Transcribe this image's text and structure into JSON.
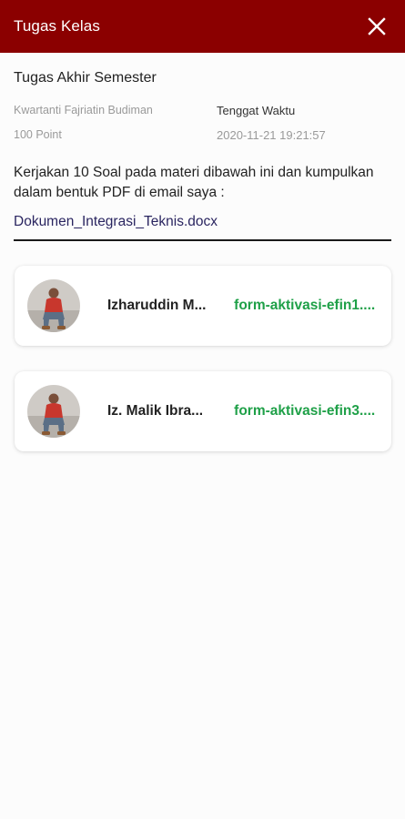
{
  "appbar": {
    "title": "Tugas Kelas",
    "close_icon": "close-icon",
    "background": "#8b0000"
  },
  "task": {
    "title": "Tugas Akhir Semester",
    "teacher": "Kwartanti Fajriatin Budiman",
    "points": "100 Point",
    "deadline_label": "Tenggat Waktu",
    "deadline_value": "2020-11-21 19:21:57",
    "description": "Kerjakan 10 Soal pada materi dibawah ini dan kumpulkan dalam bentuk PDF di email saya :",
    "attachment": "Dokumen_Integrasi_Teknis.docx"
  },
  "submissions": [
    {
      "name": "Izharuddin M...",
      "file": "form-aktivasi-efin1...."
    },
    {
      "name": "Iz. Malik Ibra...",
      "file": "form-aktivasi-efin3...."
    }
  ],
  "colors": {
    "accent": "#8b0000",
    "file_green": "#1fa048",
    "link": "#2a2560"
  }
}
